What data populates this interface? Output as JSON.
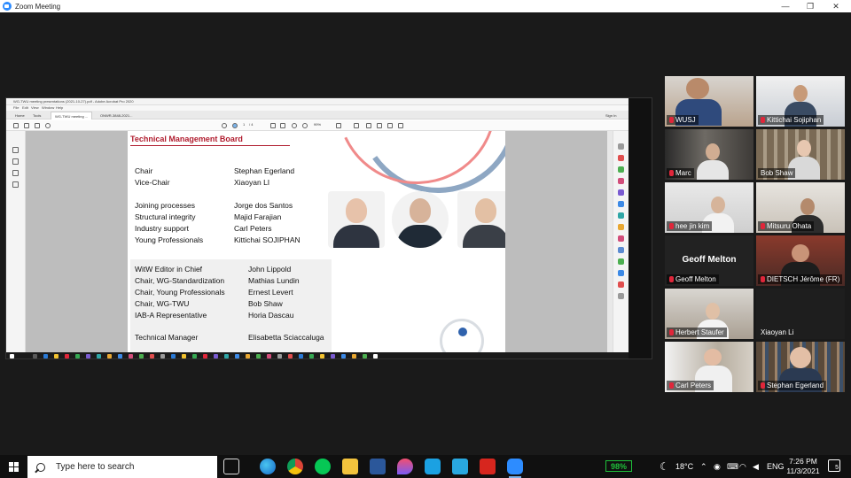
{
  "app": {
    "title": "Zoom Meeting",
    "minimize": "—",
    "maximize": "❐",
    "close": "✕"
  },
  "slide": {
    "title": "Technical Management Board",
    "rows": [
      {
        "role": "Chair",
        "name": "Stephan Egerland"
      },
      {
        "role": "Vice-Chair",
        "name": "Xiaoyan LI"
      },
      {
        "role": "Joining processes",
        "name": "Jorge dos Santos"
      },
      {
        "role": "Structural integrity",
        "name": "Majid Farajian"
      },
      {
        "role": "Industry support",
        "name": "Carl Peters"
      },
      {
        "role": "Young Professionals",
        "name": "Kittichai SOJIPHAN"
      }
    ],
    "box_rows": [
      {
        "role": "WitW Editor in Chief",
        "name": "John Lippold"
      },
      {
        "role": "Chair, WG-Standardization",
        "name": "Mathias Lundin"
      },
      {
        "role": "Chair, Young Professionals",
        "name": "Ernest Levert"
      },
      {
        "role": "Chair, WG-TWU",
        "name": "Bob Shaw"
      },
      {
        "role": "IAB-A Representative",
        "name": "Horia Dascau"
      },
      {
        "role": "Technical Manager",
        "name": "Elisabetta Sciaccaluga"
      }
    ]
  },
  "pdf_viewer": {
    "window_title": "WG-TWU meeting presentations (2021-10-27).pdf - Adobe Acrobat Pro 2020",
    "menu": [
      "File",
      "Edit",
      "View",
      "Window",
      "Help"
    ],
    "tabs": [
      "Home",
      "Tools",
      "WG-TWU meeting ...",
      "ONWR-3848-2021..."
    ],
    "signin": "Sign In",
    "zoom": "99%",
    "page_num": "1",
    "page_total": "/ 4"
  },
  "participants": [
    {
      "name": "WUSJ",
      "muted": true
    },
    {
      "name": "Kittichai Sojiphan",
      "muted": true
    },
    {
      "name": "Marc",
      "muted": true
    },
    {
      "name": "Bob Shaw",
      "muted": false
    },
    {
      "name": "hee jin kim",
      "muted": true
    },
    {
      "name": "Mitsuru Ohata",
      "muted": true
    },
    {
      "name": "Geoff Melton",
      "muted": true,
      "display": "Geoff Melton"
    },
    {
      "name": "DIETSCH Jérôme (FR)",
      "muted": true
    },
    {
      "name": "Herbert Staufer",
      "muted": true
    },
    {
      "name": "Xiaoyan Li",
      "muted": false
    },
    {
      "name": "Carl Peters",
      "muted": true
    },
    {
      "name": "Stephan Egerland",
      "muted": true,
      "speaking": true
    }
  ],
  "taskbar": {
    "search_placeholder": "Type here to search",
    "battery": "98%",
    "temperature": "18°C",
    "language": "ENG",
    "time": "7:26 PM",
    "date": "11/3/2021",
    "notifications": "5"
  },
  "colors": {
    "accent": "#2d8cff",
    "slide_title": "#b01c2e",
    "speaking": "#f7e70c",
    "muted": "#e0263a",
    "battery": "#1fc03a"
  }
}
